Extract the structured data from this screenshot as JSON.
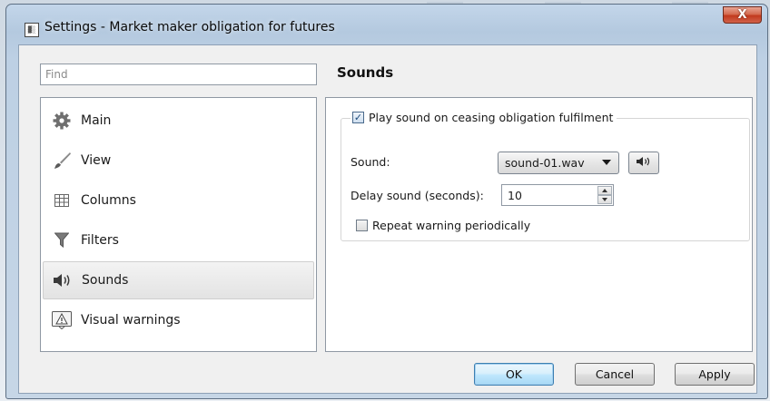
{
  "window": {
    "title": "Settings - Market maker obligation for futures",
    "close_glyph": "X",
    "app_icon_text": "▓░"
  },
  "search": {
    "placeholder": "Find",
    "value": ""
  },
  "nav": {
    "items": [
      {
        "label": "Main",
        "icon": "gear-icon"
      },
      {
        "label": "View",
        "icon": "brush-icon"
      },
      {
        "label": "Columns",
        "icon": "table-icon"
      },
      {
        "label": "Filters",
        "icon": "funnel-icon"
      },
      {
        "label": "Sounds",
        "icon": "speaker-icon",
        "selected": true
      },
      {
        "label": "Visual warnings",
        "icon": "warning-icon"
      }
    ]
  },
  "sounds": {
    "title": "Sounds",
    "play_on_cease": {
      "label": "Play sound on ceasing obligation fulfilment",
      "checked": true
    },
    "sound_label": "Sound:",
    "sound_value": "sound-01.wav",
    "delay_label": "Delay sound (seconds):",
    "delay_value": "10",
    "repeat": {
      "label": "Repeat warning periodically",
      "checked": false
    }
  },
  "buttons": {
    "ok": "OK",
    "cancel": "Cancel",
    "apply": "Apply"
  },
  "colors": {
    "accent": "#3c7fb1",
    "close": "#c1391d",
    "selection": "#e3e3e3"
  }
}
